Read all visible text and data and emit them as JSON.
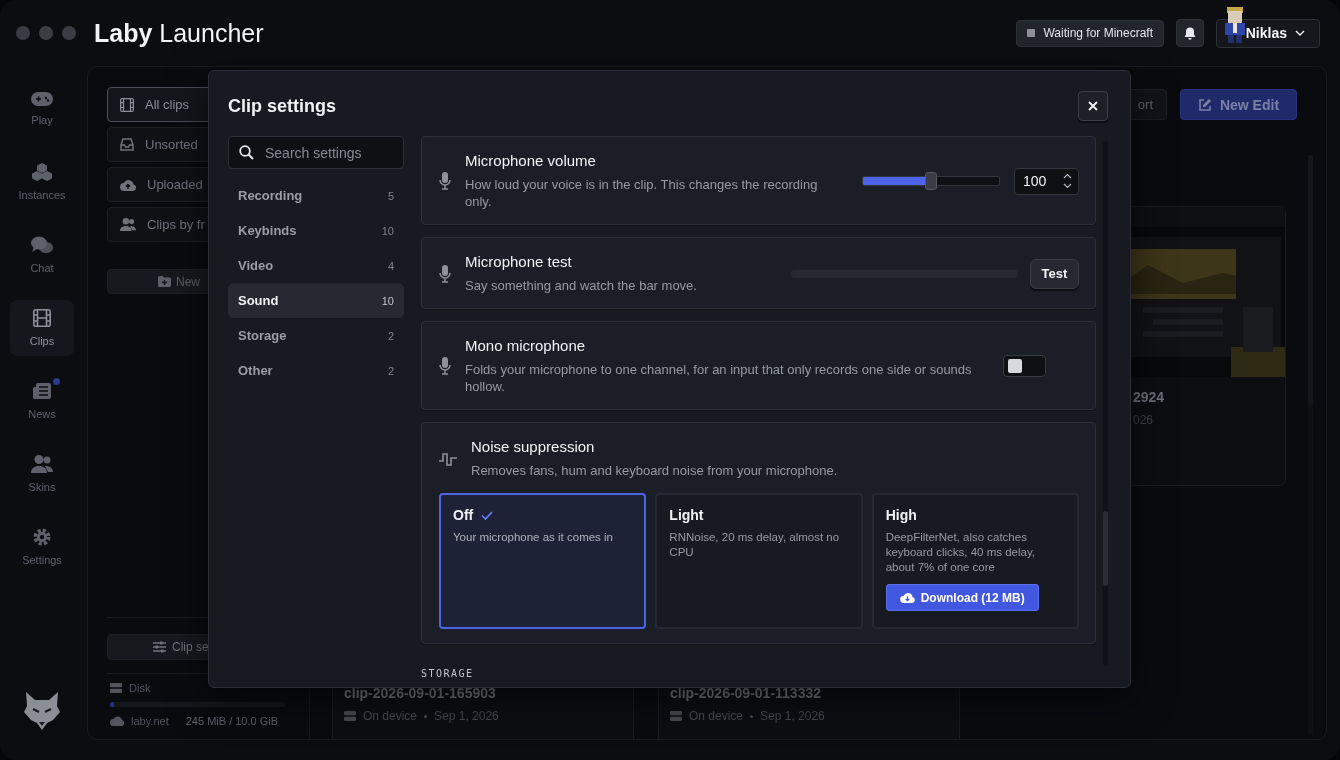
{
  "window": {
    "title": "**Laby** Launcher"
  },
  "header": {
    "status": "Waiting for Minecraft",
    "user": "Niklas"
  },
  "nav": [
    {
      "label": "Play",
      "selected": false,
      "unread": false
    },
    {
      "label": "Instances",
      "selected": false,
      "unread": false
    },
    {
      "label": "Chat",
      "selected": false,
      "unread": false
    },
    {
      "label": "Clips",
      "selected": true,
      "unread": false
    },
    {
      "label": "News",
      "selected": false,
      "unread": true
    },
    {
      "label": "Skins",
      "selected": false,
      "unread": false
    },
    {
      "label": "Settings",
      "selected": false,
      "unread": false
    }
  ],
  "clips_sidebar": {
    "items": [
      {
        "label": "All clips",
        "selected": true
      },
      {
        "label": "Unsorted",
        "selected": false
      },
      {
        "label": "Uploaded",
        "selected": false
      },
      {
        "label": "Clips by fr",
        "selected": false
      }
    ],
    "new_button": "New",
    "settings_button": "Clip se",
    "storage": {
      "label": "Disk",
      "level": 0.02,
      "provider": "laby.net",
      "usage": "245 MiB / 10.0 GiB"
    }
  },
  "toolbar": {
    "import_button": "ort",
    "new_edit_button": "New Edit"
  },
  "clips": {
    "top_right": {
      "title": "2924",
      "date": "026"
    },
    "bottom_row": [
      {
        "title": "clip-2026-09-01-165903",
        "location": "On device",
        "date": "Sep 1, 2026"
      },
      {
        "title": "clip-2026-09-01-113332",
        "location": "On device",
        "date": "Sep 1, 2026"
      }
    ]
  },
  "dialog": {
    "title": "Clip settings",
    "search": {
      "placeholder": "Search settings"
    },
    "categories": [
      {
        "label": "Recording",
        "count": "5",
        "selected": false
      },
      {
        "label": "Keybinds",
        "count": "10",
        "selected": false
      },
      {
        "label": "Video",
        "count": "4",
        "selected": false
      },
      {
        "label": "Sound",
        "count": "10",
        "selected": true
      },
      {
        "label": "Storage",
        "count": "2",
        "selected": false
      },
      {
        "label": "Other",
        "count": "2",
        "selected": false
      }
    ],
    "settings": [
      {
        "kind": "slider",
        "title": "Microphone volume",
        "description": "How loud your voice is in the clip. This changes the recording only.",
        "level": 0.5,
        "value": "100"
      },
      {
        "kind": "meter",
        "title": "Microphone test",
        "description": "Say something and watch the bar move.",
        "level": 0,
        "button": "Test"
      },
      {
        "kind": "toggle",
        "title": "Mono microphone",
        "description": "Folds your microphone to one channel, for an input that only records one side or sounds hollow.",
        "on": false
      },
      {
        "kind": "choice",
        "title": "Noise suppression",
        "description": "Removes fans, hum and keyboard noise from your microphone.",
        "options": [
          {
            "label": "Off",
            "description": "Your microphone as it comes in",
            "selected": true
          },
          {
            "label": "Light",
            "description": "RNNoise, 20 ms delay, almost no CPU",
            "selected": false
          },
          {
            "label": "High",
            "description": "DeepFilterNet, also catches keyboard clicks, 40 ms delay, about 7% of one core",
            "selected": false,
            "action": "Download (12 MB)"
          }
        ]
      }
    ],
    "next_section": "STORAGE"
  }
}
